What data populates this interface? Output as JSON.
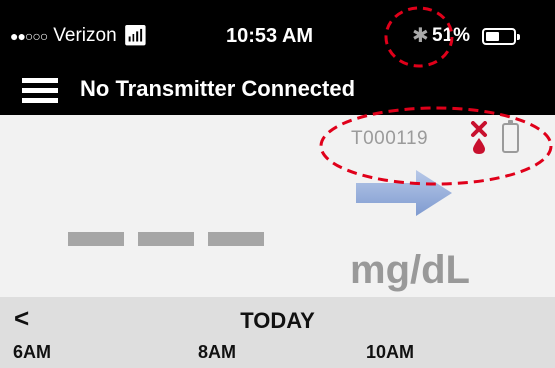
{
  "status_bar": {
    "signal": "●●○○○",
    "carrier": "Verizon",
    "wifi_icon": "wifi-icon",
    "time": "10:53 AM",
    "bluetooth_icon": "bluetooth-icon",
    "battery_percent": "51%",
    "battery_level": 0.51
  },
  "nav": {
    "menu_icon": "hamburger-menu-icon",
    "title": "No Transmitter Connected"
  },
  "transmitter": {
    "id": "T000119",
    "error_icon": "blood-drop-error-icon",
    "battery_icon": "sensor-battery-icon"
  },
  "reading": {
    "trend_icon": "trend-arrow-right-icon",
    "unit": "mg/dL"
  },
  "graph": {
    "back_icon": "chevron-left-icon",
    "back_label": "<",
    "day_label": "TODAY",
    "time_ticks": [
      "6AM",
      "8AM",
      "10AM"
    ]
  },
  "colors": {
    "bar_background": "#000000",
    "content_background": "#f2f2f2",
    "graph_header_background": "#dedede",
    "error_red": "#c8102e",
    "trend_arrow": "#8fa9d8",
    "callout": "#e0001a",
    "muted_text": "#9b9b9b"
  }
}
